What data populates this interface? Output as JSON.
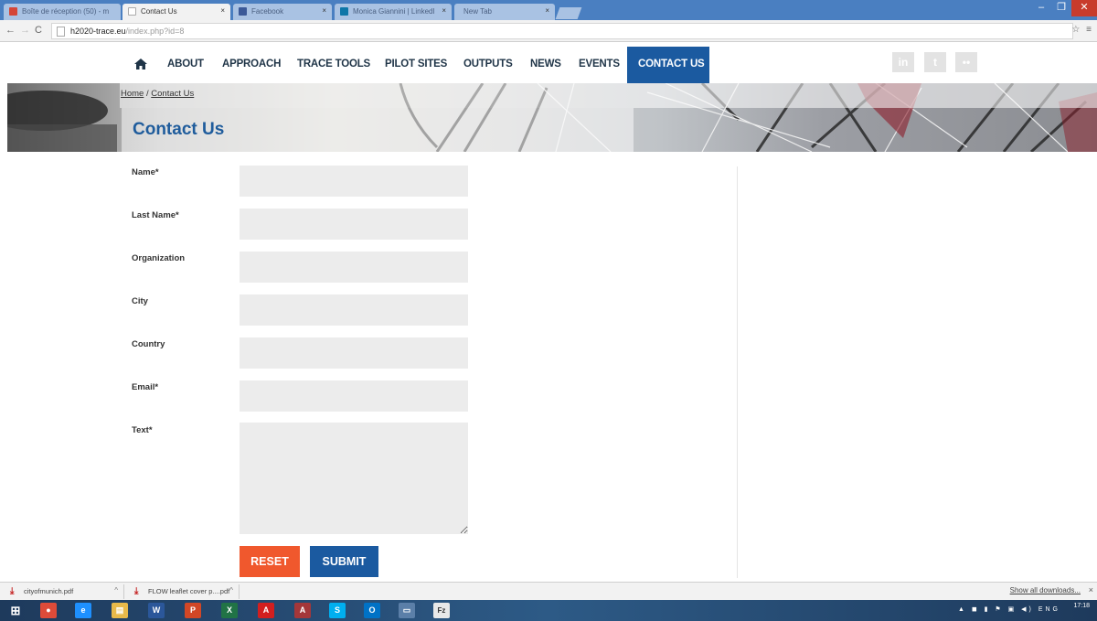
{
  "browser": {
    "tabs": [
      {
        "label": "Boîte de réception (50) - m",
        "icon": "gmail-icon",
        "color": "#d44638"
      },
      {
        "label": "Contact Us",
        "icon": "page-icon",
        "color": "#ffffff"
      },
      {
        "label": "Facebook",
        "icon": "facebook-icon",
        "color": "#3b5998"
      },
      {
        "label": "Monica Giannini | LinkedI",
        "icon": "linkedin-icon",
        "color": "#0e76a8"
      },
      {
        "label": "New Tab",
        "icon": "",
        "color": ""
      }
    ],
    "window_controls": {
      "minimize": "–",
      "maximize": "❐",
      "close": "✕"
    },
    "url_domain": "h2020-trace.eu",
    "url_path": "/index.php?id=8",
    "toolbar_right": "☆ ≡"
  },
  "site": {
    "nav": [
      {
        "label": "ABOUT"
      },
      {
        "label": "APPROACH"
      },
      {
        "label": "TRACE TOOLS"
      },
      {
        "label": "PILOT SITES"
      },
      {
        "label": "OUTPUTS"
      },
      {
        "label": "NEWS"
      },
      {
        "label": "EVENTS"
      },
      {
        "label": "CONTACT US",
        "active": true
      }
    ],
    "social": {
      "linkedin": "in",
      "twitter": "t",
      "flickr": "••"
    },
    "breadcrumb": {
      "home": "Home",
      "separator": " / ",
      "current": "Contact Us"
    },
    "page_title": "Contact Us",
    "accent_color": "#1b5aa0",
    "reset_color": "#f0582d"
  },
  "form": {
    "fields": [
      {
        "label": "Name*",
        "value": ""
      },
      {
        "label": "Last Name*",
        "value": ""
      },
      {
        "label": "Organization",
        "value": ""
      },
      {
        "label": "City",
        "value": ""
      },
      {
        "label": "Country",
        "value": ""
      },
      {
        "label": "Email*",
        "value": ""
      }
    ],
    "text_label": "Text*",
    "reset_label": "RESET",
    "submit_label": "SUBMIT"
  },
  "downloads": {
    "items": [
      {
        "name": "cityofmunich.pdf"
      },
      {
        "name": "FLOW leaflet cover p....pdf"
      }
    ],
    "show_all": "Show all downloads...",
    "close": "×"
  },
  "taskbar": {
    "apps": [
      {
        "name": "start-button",
        "glyph": "⊞",
        "color": "#2d5a86"
      },
      {
        "name": "chrome-icon",
        "glyph": "●",
        "color": "#dd4b39"
      },
      {
        "name": "internet-explorer-icon",
        "glyph": "e",
        "color": "#1e90ff"
      },
      {
        "name": "file-explorer-icon",
        "glyph": "▤",
        "color": "#e8b94a"
      },
      {
        "name": "word-icon",
        "glyph": "W",
        "color": "#2b579a"
      },
      {
        "name": "powerpoint-icon",
        "glyph": "P",
        "color": "#d24726"
      },
      {
        "name": "excel-icon",
        "glyph": "X",
        "color": "#217346"
      },
      {
        "name": "acrobat-icon",
        "glyph": "A",
        "color": "#d21f1f"
      },
      {
        "name": "access-icon",
        "glyph": "A",
        "color": "#a4373a"
      },
      {
        "name": "skype-icon",
        "glyph": "S",
        "color": "#00aff0"
      },
      {
        "name": "outlook-icon",
        "glyph": "O",
        "color": "#0072c6"
      },
      {
        "name": "monitor-icon",
        "glyph": "▭",
        "color": "#5b7fa8"
      },
      {
        "name": "filezilla-icon",
        "glyph": "Fz",
        "color": "#333333"
      }
    ],
    "tray": "▲ ◼ ▮ ⚑ ▣ ◀) ENG",
    "time": "17:18"
  }
}
